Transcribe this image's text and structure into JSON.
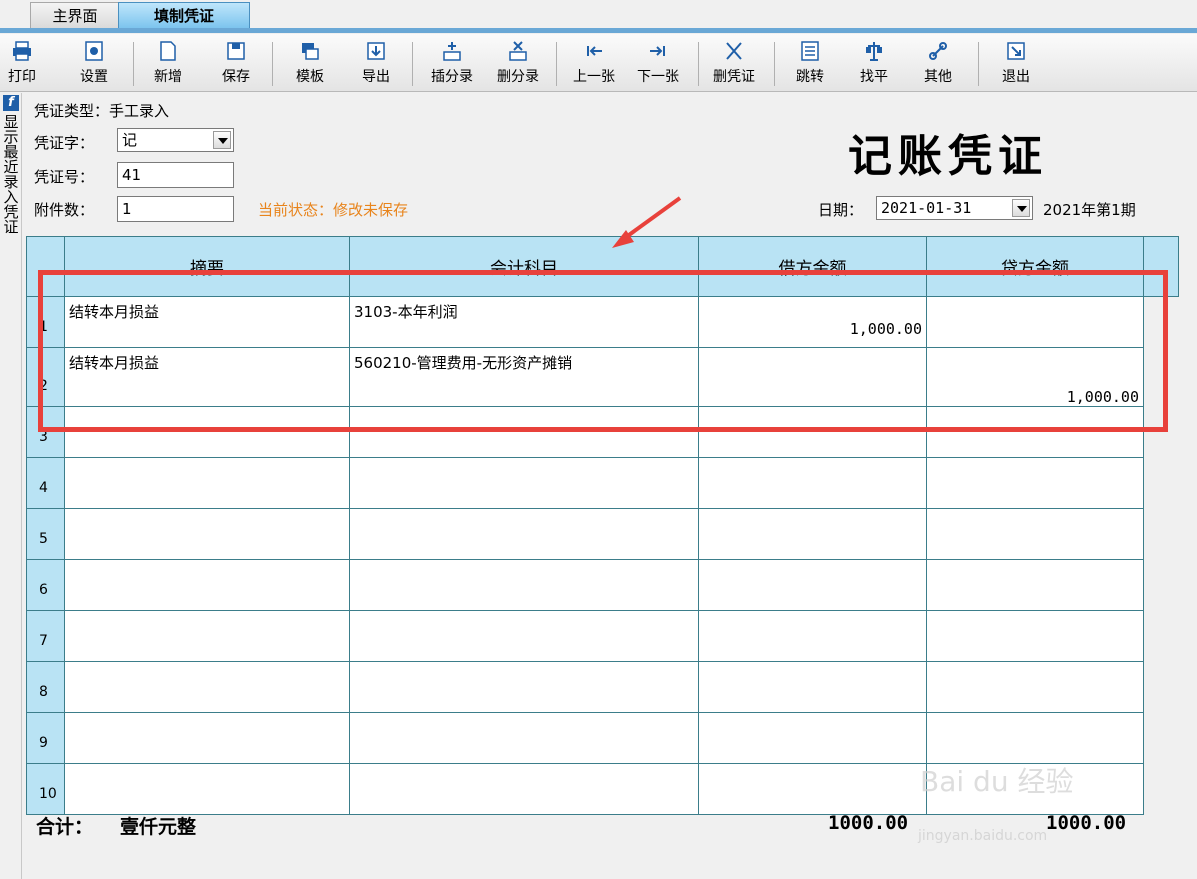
{
  "tabs": {
    "home": "主界面",
    "active": "填制凭证"
  },
  "toolbar": {
    "print": "打印",
    "settings": "设置",
    "new": "新增",
    "save": "保存",
    "template": "模板",
    "export": "导出",
    "insert_entry": "插分录",
    "delete_entry": "删分录",
    "prev": "上一张",
    "next": "下一张",
    "delete_voucher": "删凭证",
    "jump": "跳转",
    "balance": "找平",
    "other": "其他",
    "exit": "退出"
  },
  "side_panel": {
    "label": "显示最近录入凭证"
  },
  "form": {
    "voucher_type_label": "凭证类型：",
    "voucher_type_value": "手工录入",
    "voucher_word_label": "凭证字：",
    "voucher_word_value": "记",
    "voucher_no_label": "凭证号：",
    "voucher_no_value": "41",
    "attachments_label": "附件数：",
    "attachments_value": "1",
    "status_label": "当前状态：",
    "status_value": "修改未保存",
    "title": "记账凭证",
    "date_label": "日期：",
    "date_value": "2021-01-31",
    "period": "2021年第1期"
  },
  "grid": {
    "columns": [
      "摘要",
      "会计科目",
      "借方金额",
      "贷方金额"
    ],
    "rows": [
      {
        "no": "1",
        "summary": "结转本月损益",
        "account": "3103-本年利润",
        "debit": "1,000.00",
        "credit": ""
      },
      {
        "no": "2",
        "summary": "结转本月损益",
        "account": "560210-管理费用-无形资产摊销",
        "debit": "",
        "credit": "1,000.00"
      },
      {
        "no": "3",
        "summary": "",
        "account": "",
        "debit": "",
        "credit": ""
      },
      {
        "no": "4",
        "summary": "",
        "account": "",
        "debit": "",
        "credit": ""
      },
      {
        "no": "5",
        "summary": "",
        "account": "",
        "debit": "",
        "credit": ""
      },
      {
        "no": "6",
        "summary": "",
        "account": "",
        "debit": "",
        "credit": ""
      },
      {
        "no": "7",
        "summary": "",
        "account": "",
        "debit": "",
        "credit": ""
      },
      {
        "no": "8",
        "summary": "",
        "account": "",
        "debit": "",
        "credit": ""
      },
      {
        "no": "9",
        "summary": "",
        "account": "",
        "debit": "",
        "credit": ""
      },
      {
        "no": "10",
        "summary": "",
        "account": "",
        "debit": "",
        "credit": ""
      }
    ]
  },
  "totals": {
    "label": "合计：",
    "amount_words": "壹仟元整",
    "debit_total": "1000.00",
    "credit_total": "1000.00"
  },
  "watermark": {
    "brand": "Bai du 经验",
    "url": "jingyan.baidu.com"
  },
  "colors": {
    "header_blue": "#b9e3f4",
    "grid_line": "#3b7d8a",
    "status_orange": "#e8841c",
    "annotation_red": "#e8413b"
  }
}
